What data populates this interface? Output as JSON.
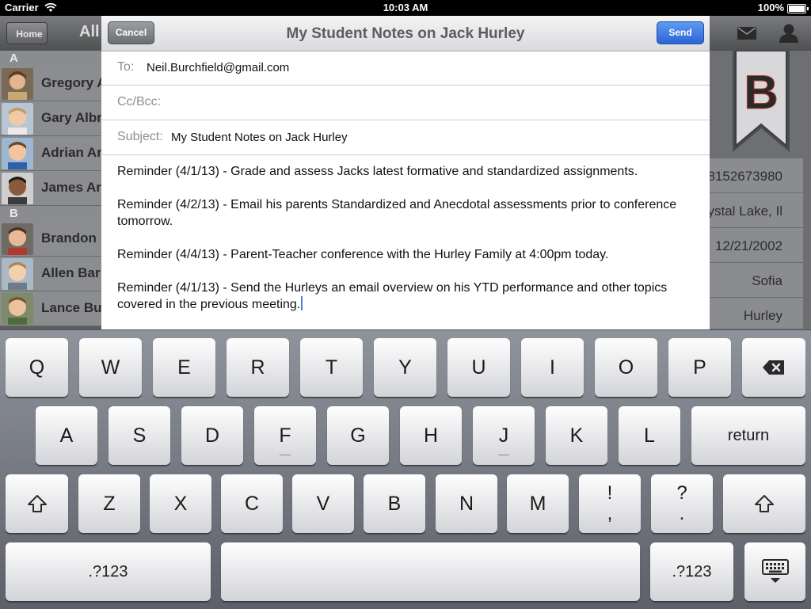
{
  "status_bar": {
    "carrier": "Carrier",
    "time": "10:03 AM",
    "battery": "100%"
  },
  "background_app": {
    "home_button": "Home",
    "nav_title": "All",
    "sections": [
      {
        "letter": "A",
        "students": [
          "Gregory A",
          "Gary Albr",
          "Adrian Ar",
          "James Ar"
        ]
      },
      {
        "letter": "B",
        "students": [
          "Brandon",
          "Allen Bar",
          "Lance Bu"
        ]
      }
    ],
    "letter_tab": "B",
    "detail_values": [
      "8152673980",
      "rystal Lake, Il",
      "12/21/2002",
      "Sofia",
      "Hurley"
    ]
  },
  "compose": {
    "cancel_label": "Cancel",
    "title": "My Student Notes on Jack Hurley",
    "send_label": "Send",
    "to_label": "To:",
    "to_value": "Neil.Burchfield@gmail.com",
    "ccbcc_label": "Cc/Bcc:",
    "subject_label": "Subject:",
    "subject_value": "My Student Notes on Jack Hurley",
    "body": [
      "Reminder (4/1/13) - Grade and assess Jacks latest formative and standardized assignments.",
      "Reminder (4/2/13) - Email his parents Standardized and Anecdotal assessments prior to conference tomorrow.",
      "Reminder (4/4/13) - Parent-Teacher conference with the Hurley Family at 4:00pm today.",
      "Reminder (4/1/13) - Send the Hurleys an email overview on his YTD performance and other topics covered in the previous meeting."
    ]
  },
  "keyboard": {
    "row1": [
      "Q",
      "W",
      "E",
      "R",
      "T",
      "Y",
      "U",
      "I",
      "O",
      "P"
    ],
    "row2": [
      "A",
      "S",
      "D",
      "F",
      "G",
      "H",
      "J",
      "K",
      "L"
    ],
    "row3": [
      "Z",
      "X",
      "C",
      "V",
      "B",
      "N",
      "M"
    ],
    "return_label": "return",
    "exclaim_top": "!",
    "exclaim_bottom": ",",
    "question_top": "?",
    "question_bottom": ".",
    "numbers_label": ".?123",
    "icons": [
      "backspace-icon",
      "shift-icon",
      "hide-keyboard-icon"
    ]
  }
}
